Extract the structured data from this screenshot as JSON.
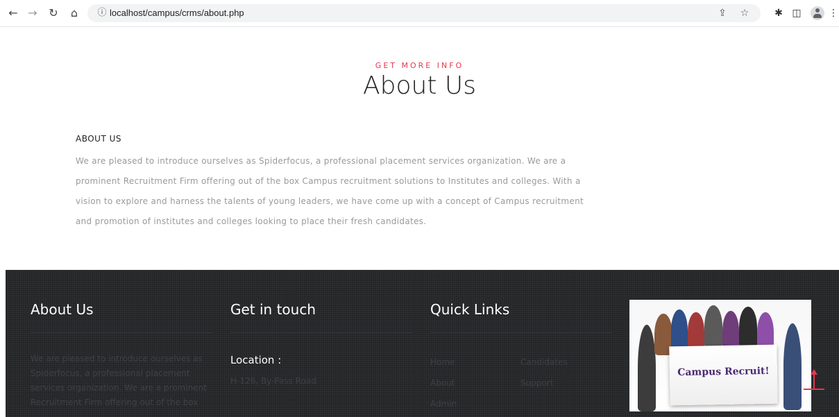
{
  "browser": {
    "back_icon": "arrow-left-icon",
    "forward_icon": "arrow-right-icon",
    "reload_icon": "reload-icon",
    "home_icon": "home-icon",
    "url": "localhost/campus/crms/about.php"
  },
  "header": {
    "eyebrow": "GET MORE INFO",
    "title": "About Us"
  },
  "about": {
    "heading": "ABOUT US",
    "body": "We are pleased to introduce ourselves as Spiderfocus, a professional placement services organization. We are a prominent Recruitment Firm offering out of the box Campus recruitment solutions to Institutes and colleges. With a vision to explore and harness the talents of young leaders, we have come up with a concept of Campus recruitment and promotion of institutes and colleges looking to place their fresh candidates."
  },
  "footer": {
    "about": {
      "title": "About Us",
      "lines": [
        "We are pleased to introduce ourselves as",
        "Spiderfocus, a professional placement",
        "services organization. We are a prominent",
        "Recruitment Firm offering out of the box"
      ]
    },
    "contact": {
      "title": "Get in touch",
      "location_label": "Location :",
      "location_value": "H-126, By-Pass Road"
    },
    "quick_links": {
      "title": "Quick Links",
      "col1": [
        "Home",
        "About",
        "Admin"
      ],
      "col2": [
        "Candidates",
        "Support"
      ]
    },
    "image_banner_text": "Campus Recruit!"
  },
  "colors": {
    "accent": "#e8364b",
    "footer_bg": "#222426"
  }
}
